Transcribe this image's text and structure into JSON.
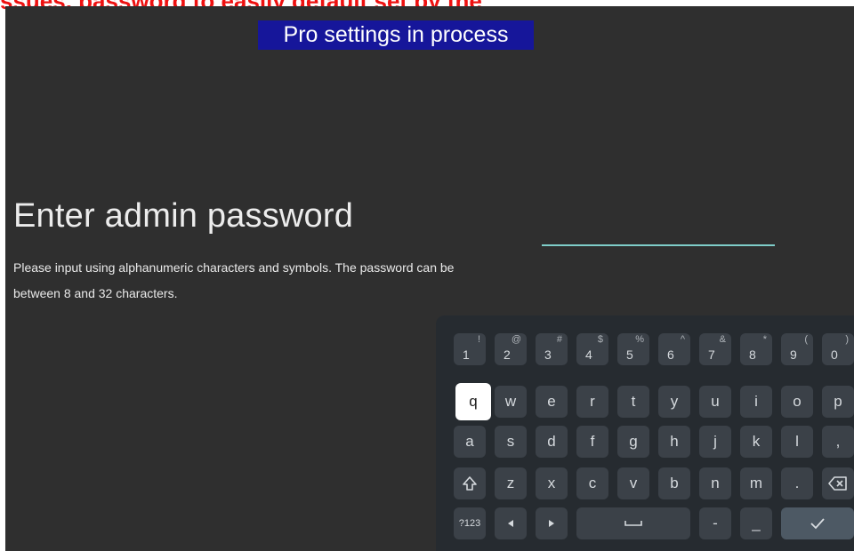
{
  "top_caption": "ssues, password to easily default set by the",
  "banner": "Pro settings in process",
  "heading": "Enter admin password",
  "description": "Please input using alphanumeric characters and symbols. The password can be between 8 and 32 characters.",
  "password": {
    "value": "",
    "placeholder": ""
  },
  "keyboard": {
    "number_row": [
      {
        "main": "1",
        "sub": "!"
      },
      {
        "main": "2",
        "sub": "@"
      },
      {
        "main": "3",
        "sub": "#"
      },
      {
        "main": "4",
        "sub": "$"
      },
      {
        "main": "5",
        "sub": "%"
      },
      {
        "main": "6",
        "sub": "^"
      },
      {
        "main": "7",
        "sub": "&"
      },
      {
        "main": "8",
        "sub": "*"
      },
      {
        "main": "9",
        "sub": "("
      },
      {
        "main": "0",
        "sub": ")"
      }
    ],
    "row1": [
      "q",
      "w",
      "e",
      "r",
      "t",
      "y",
      "u",
      "i",
      "o",
      "p"
    ],
    "row2": [
      "a",
      "s",
      "d",
      "f",
      "g",
      "h",
      "j",
      "k",
      "l",
      ","
    ],
    "row3": [
      "z",
      "x",
      "c",
      "v",
      "b",
      "n",
      "m",
      "."
    ],
    "symbols_label": "?123",
    "dash": "-",
    "underscore": "_",
    "focused_key": "q",
    "colors": {
      "key": "#3b4148",
      "focused": "#ffffff",
      "panel": "#262b30",
      "accent_line": "#7fcdc9"
    }
  }
}
